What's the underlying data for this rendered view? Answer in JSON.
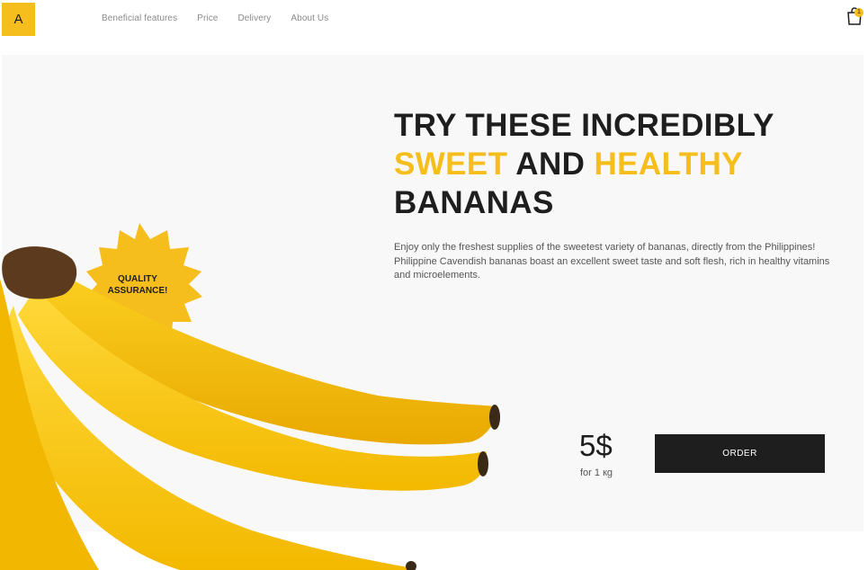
{
  "header": {
    "logo_letter": "A",
    "nav": [
      "Beneficial features",
      "Price",
      "Delivery",
      "About Us"
    ],
    "cart_count": "1",
    "cart_icon": "shopping-bag-icon"
  },
  "hero": {
    "title_line1": "TRY THESE INCREDIBLY",
    "title_sweet": "SWEET",
    "title_and": "AND",
    "title_healthy": "HEALTHY",
    "title_line3": "BANANAS",
    "description": "Enjoy only the freshest supplies of the sweetest variety of bananas, directly from the Philippines! Philippine Cavendish bananas boast an excellent sweet taste and soft flesh, rich in healthy vitamins and microelements.",
    "badge_line1": "QUALITY",
    "badge_line2": "ASSURANCE!",
    "price": "5$",
    "price_unit": "for 1 кg",
    "order_label": "ORDER"
  },
  "colors": {
    "accent": "#f6be1c",
    "dark": "#1e1e1e",
    "hero_bg": "#f8f8f8"
  }
}
